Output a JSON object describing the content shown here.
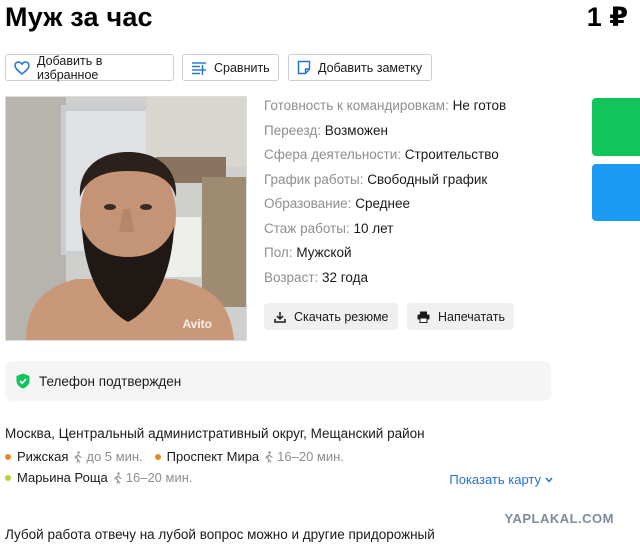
{
  "listing": {
    "title": "Муж за час",
    "price": "1 ₽"
  },
  "toolbar": {
    "favorite_label": "Добавить в избранное",
    "compare_label": "Сравнить",
    "note_label": "Добавить заметку"
  },
  "photo": {
    "watermark": "Avito"
  },
  "params": [
    {
      "key": "Готовность к командировкам:",
      "value": "Не готов"
    },
    {
      "key": "Переезд:",
      "value": "Возможен"
    },
    {
      "key": "Сфера деятельности:",
      "value": "Строительство"
    },
    {
      "key": "График работы:",
      "value": "Свободный график"
    },
    {
      "key": "Образование:",
      "value": "Среднее"
    },
    {
      "key": "Стаж работы:",
      "value": "10 лет"
    },
    {
      "key": "Пол:",
      "value": "Мужской"
    },
    {
      "key": "Возраст:",
      "value": "32 года"
    }
  ],
  "actions": {
    "download_label": "Скачать резюме",
    "print_label": "Напечатать"
  },
  "verified": {
    "label": "Телефон подтвержден"
  },
  "location": {
    "address": "Москва, Центральный административный округ, Мещанский район",
    "stations": [
      {
        "name": "Рижская",
        "walk": "до 5 мин.",
        "color": "#e8862a"
      },
      {
        "name": "Проспект Мира",
        "walk": "16–20 мин.",
        "color": "#e8862a"
      },
      {
        "name": "Марьина Роща",
        "walk": "16–20 мин.",
        "color": "#b9cf2c"
      }
    ],
    "map_link": "Показать карту"
  },
  "description": {
    "text": "Лубой работа отвечу на лубой вопрос можно и другие придорожный"
  },
  "site_watermark": "YAPLAKAL.COM",
  "colors": {
    "green_side": "#12c45a",
    "blue_side": "#1a9af0",
    "link": "#1e73d8"
  }
}
